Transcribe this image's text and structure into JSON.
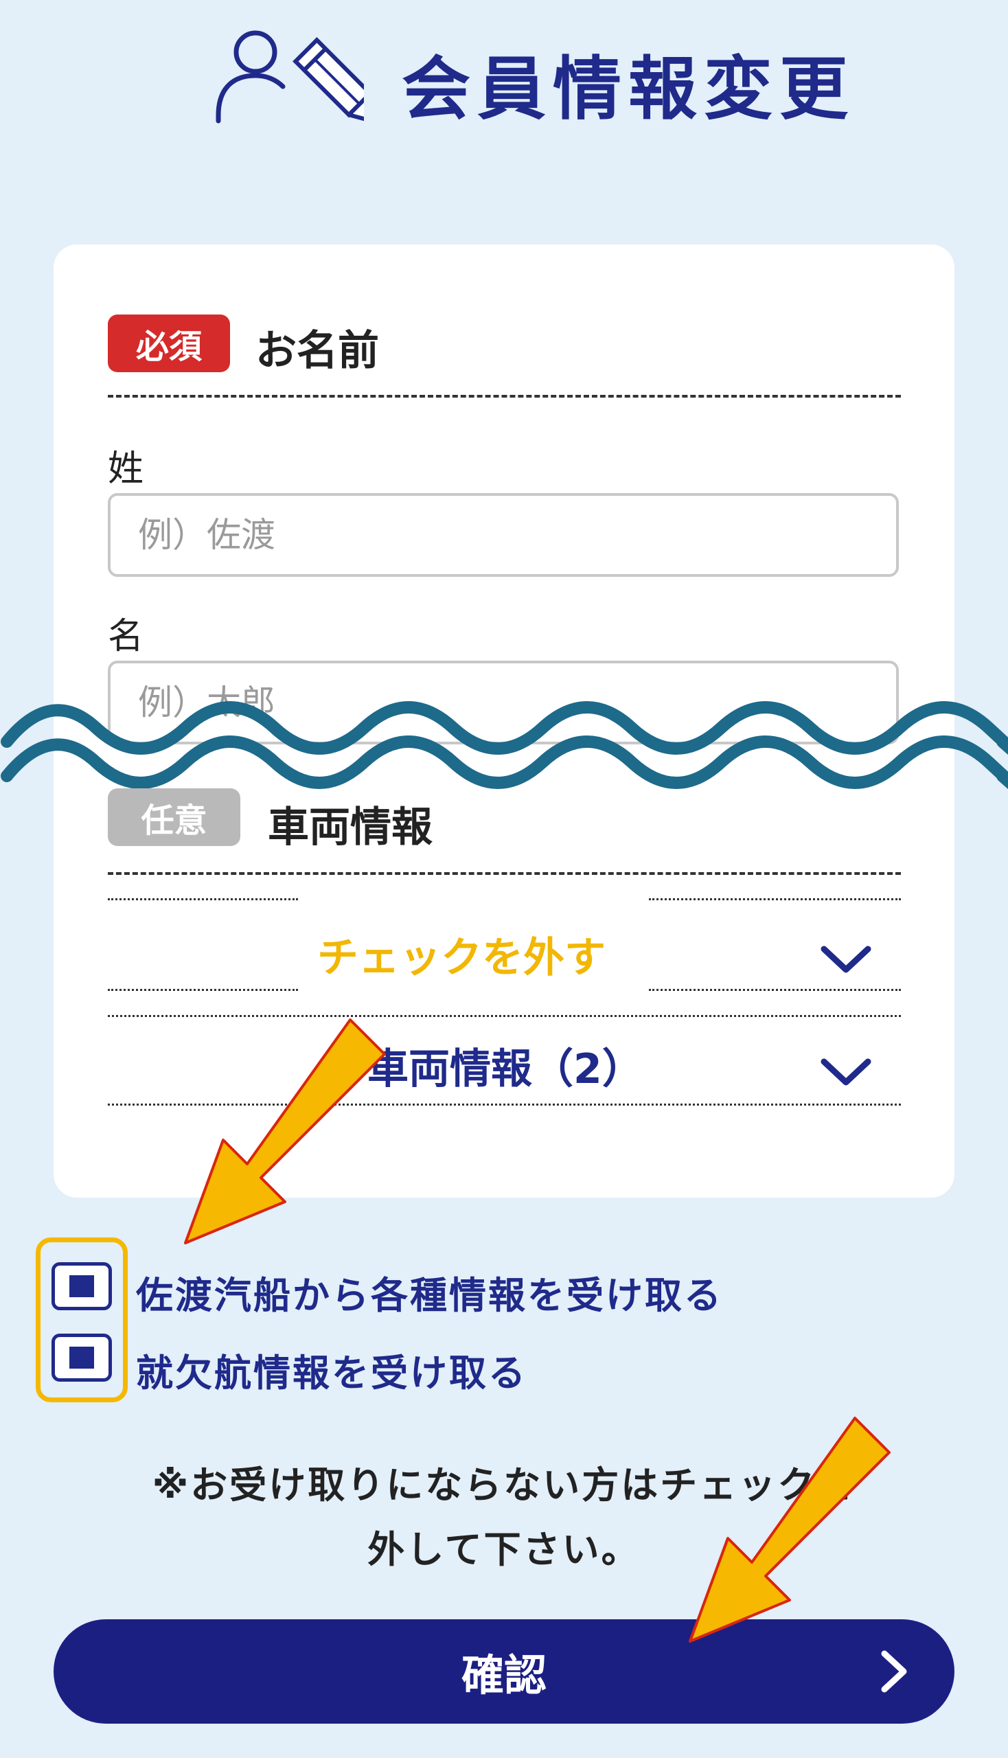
{
  "header": {
    "title": "会員情報変更",
    "icon": "user-edit-icon"
  },
  "name_section": {
    "badge": "必須",
    "title": "お名前",
    "last_name": {
      "label": "姓",
      "value": "",
      "placeholder": "例）佐渡"
    },
    "first_name": {
      "label": "名",
      "value": "",
      "placeholder": "例）太郎"
    }
  },
  "vehicle_section": {
    "badge": "任意",
    "title": "車両情報",
    "accordions": [
      {
        "label": "チェックを外す"
      },
      {
        "label": "車両情報（2）"
      }
    ]
  },
  "checkboxes": [
    {
      "label": "佐渡汽船から各種情報を受け取る",
      "checked": true
    },
    {
      "label": "就欠航情報を受け取る",
      "checked": true
    }
  ],
  "notice": {
    "line1": "※お受け取りにならない方はチェックを",
    "line2": "外して下さい。"
  },
  "confirm_button": {
    "label": "確認"
  },
  "colors": {
    "background": "#e3eff9",
    "navy": "#1f2a8a",
    "required": "#d52b2b",
    "optional": "#b9b9b9",
    "highlight": "#f5b800",
    "wave": "#1e6a8a"
  }
}
